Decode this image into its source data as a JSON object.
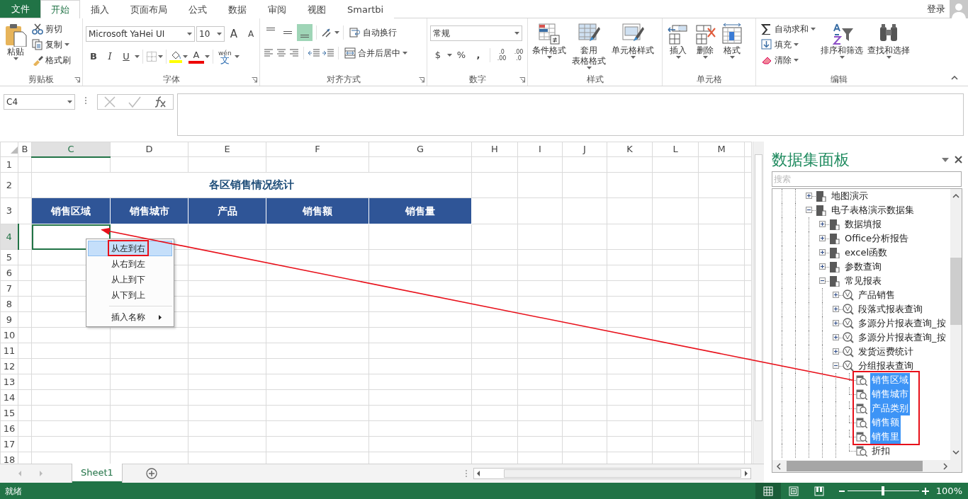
{
  "title_bar": {
    "file_tab": "文件",
    "tabs": [
      {
        "label": "开始",
        "selected": true
      },
      {
        "label": "插入",
        "selected": false
      },
      {
        "label": "页面布局",
        "selected": false
      },
      {
        "label": "公式",
        "selected": false
      },
      {
        "label": "数据",
        "selected": false
      },
      {
        "label": "审阅",
        "selected": false
      },
      {
        "label": "视图",
        "selected": false
      },
      {
        "label": "Smartbi",
        "selected": false
      }
    ],
    "sign_in": "登录"
  },
  "ribbon": {
    "clipboard": {
      "label": "剪贴板",
      "paste": "粘贴",
      "cut": "剪切",
      "copy": "复制",
      "format_painter": "格式刷"
    },
    "font": {
      "label": "字体",
      "font_name": "Microsoft YaHei UI",
      "font_size": "10",
      "grow": "A",
      "shrink": "A",
      "bold": "B",
      "italic": "I",
      "underline": "U",
      "font_color": "A",
      "phonetic_top": "wén",
      "phonetic_main": "文"
    },
    "alignment": {
      "label": "对齐方式",
      "vertical": [
        {
          "selected": false
        },
        {
          "selected": false
        },
        {
          "selected": true
        }
      ],
      "wrap": "自动换行",
      "merge": "合并后居中"
    },
    "number": {
      "label": "数字",
      "format": "常规",
      "currency": "$",
      "percent": "%",
      "comma": ",",
      "increase_decimal": [
        ".0",
        ".00"
      ],
      "decrease_decimal": [
        ".00",
        ".0"
      ]
    },
    "styles": {
      "label": "样式",
      "buttons": [
        {
          "kind": "conditional",
          "lines": [
            "条件格式"
          ]
        },
        {
          "kind": "table",
          "lines": [
            "套用",
            "表格格式"
          ]
        },
        {
          "kind": "cellstyle",
          "lines": [
            "单元格样式"
          ]
        }
      ]
    },
    "cells": {
      "label": "单元格",
      "buttons": [
        {
          "kind": "insert",
          "lines": [
            "插入"
          ]
        },
        {
          "kind": "delete",
          "lines": [
            "删除"
          ]
        },
        {
          "kind": "format",
          "lines": [
            "格式"
          ]
        }
      ]
    },
    "editing": {
      "label": "编辑",
      "small": [
        {
          "kind": "sum",
          "text": "自动求和"
        },
        {
          "kind": "fill",
          "text": "填充"
        },
        {
          "kind": "clear",
          "text": "清除"
        }
      ],
      "buttons": [
        {
          "kind": "sort",
          "lines": [
            "排序和筛选"
          ]
        },
        {
          "kind": "find",
          "lines": [
            "查找和选择"
          ]
        }
      ]
    }
  },
  "formula_bar": {
    "name_box": "C4"
  },
  "sheet": {
    "columns": [
      {
        "label": "B",
        "selected": false
      },
      {
        "label": "C",
        "selected": true
      },
      {
        "label": "D",
        "selected": false
      },
      {
        "label": "E",
        "selected": false
      },
      {
        "label": "F",
        "selected": false
      },
      {
        "label": "G",
        "selected": false
      },
      {
        "label": "H",
        "selected": false
      },
      {
        "label": "I",
        "selected": false
      },
      {
        "label": "J",
        "selected": false
      },
      {
        "label": "K",
        "selected": false
      },
      {
        "label": "L",
        "selected": false
      },
      {
        "label": "M",
        "selected": false
      }
    ],
    "rows": [
      {
        "label": "1",
        "kind": "blank",
        "selected": false
      },
      {
        "label": "2",
        "kind": "title",
        "selected": false,
        "title": "各区销售情况统计"
      },
      {
        "label": "3",
        "kind": "header",
        "selected": false,
        "cells": [
          "销售区域",
          "销售城市",
          "产品",
          "销售额",
          "销售量"
        ]
      },
      {
        "label": "4",
        "kind": "blank",
        "selected": true
      },
      {
        "label": "5",
        "kind": "blank",
        "selected": false
      },
      {
        "label": "6",
        "kind": "blank",
        "selected": false
      },
      {
        "label": "7",
        "kind": "blank",
        "selected": false
      },
      {
        "label": "8",
        "kind": "blank",
        "selected": false
      },
      {
        "label": "9",
        "kind": "blank",
        "selected": false
      },
      {
        "label": "10",
        "kind": "blank",
        "selected": false
      },
      {
        "label": "11",
        "kind": "blank",
        "selected": false
      },
      {
        "label": "12",
        "kind": "blank",
        "selected": false
      },
      {
        "label": "13",
        "kind": "blank",
        "selected": false
      },
      {
        "label": "14",
        "kind": "blank",
        "selected": false
      },
      {
        "label": "15",
        "kind": "blank",
        "selected": false
      },
      {
        "label": "16",
        "kind": "blank",
        "selected": false
      },
      {
        "label": "17",
        "kind": "blank",
        "selected": false
      },
      {
        "label": "18",
        "kind": "blank",
        "selected": false
      }
    ]
  },
  "context_menu": {
    "items": [
      {
        "label": "从左到右",
        "kind": "item",
        "selected": true
      },
      {
        "label": "从右到左",
        "kind": "item",
        "selected": false
      },
      {
        "label": "从上到下",
        "kind": "item",
        "selected": false
      },
      {
        "label": "从下到上",
        "kind": "item",
        "selected": false
      },
      {
        "label": "插入名称",
        "kind": "submenu",
        "selected": false
      }
    ]
  },
  "sheet_tabs": [
    {
      "label": "Sheet1",
      "selected": true
    }
  ],
  "panel": {
    "title": "数据集面板",
    "search": {
      "placeholder": "搜索"
    },
    "tree": [
      {
        "label": "地图演示",
        "kind": "folder",
        "expanded": false,
        "selected": false
      },
      {
        "label": "电子表格演示数据集",
        "kind": "folder",
        "expanded": true,
        "selected": false,
        "children": [
          {
            "label": "数据填报",
            "kind": "folder",
            "expanded": false,
            "selected": false
          },
          {
            "label": "Office分析报告",
            "kind": "folder",
            "expanded": false,
            "selected": false
          },
          {
            "label": "excel函数",
            "kind": "folder",
            "expanded": false,
            "selected": false
          },
          {
            "label": "参数查询",
            "kind": "folder",
            "expanded": false,
            "selected": false
          },
          {
            "label": "常见报表",
            "kind": "folder",
            "expanded": true,
            "selected": false,
            "children": [
              {
                "label": "产品销售",
                "kind": "query",
                "expanded": false,
                "selected": false
              },
              {
                "label": "段落式报表查询",
                "kind": "query",
                "expanded": false,
                "selected": false
              },
              {
                "label": "多源分片报表查询_按",
                "kind": "query",
                "expanded": false,
                "selected": false
              },
              {
                "label": "多源分片报表查询_按",
                "kind": "query",
                "expanded": false,
                "selected": false
              },
              {
                "label": "发货运费统计",
                "kind": "query",
                "expanded": false,
                "selected": false
              },
              {
                "label": "分组报表查询",
                "kind": "query",
                "expanded": true,
                "selected": false,
                "children": [
                  {
                    "label": "销售区域",
                    "kind": "field",
                    "selected": true
                  },
                  {
                    "label": "销售城市",
                    "kind": "field",
                    "selected": true
                  },
                  {
                    "label": "产品类别",
                    "kind": "field",
                    "selected": true
                  },
                  {
                    "label": "销售额",
                    "kind": "field",
                    "selected": true
                  },
                  {
                    "label": "销售里",
                    "kind": "field",
                    "selected": true
                  },
                  {
                    "label": "折扣",
                    "kind": "field",
                    "selected": false
                  }
                ]
              }
            ]
          }
        ]
      }
    ]
  },
  "status_bar": {
    "status": "就绪",
    "views": [
      {
        "kind": "normal",
        "selected": true
      },
      {
        "kind": "layout",
        "selected": false
      },
      {
        "kind": "pagebreak",
        "selected": false
      }
    ],
    "zoom": {
      "level": 0.5
    },
    "zoom_text": "100%"
  }
}
